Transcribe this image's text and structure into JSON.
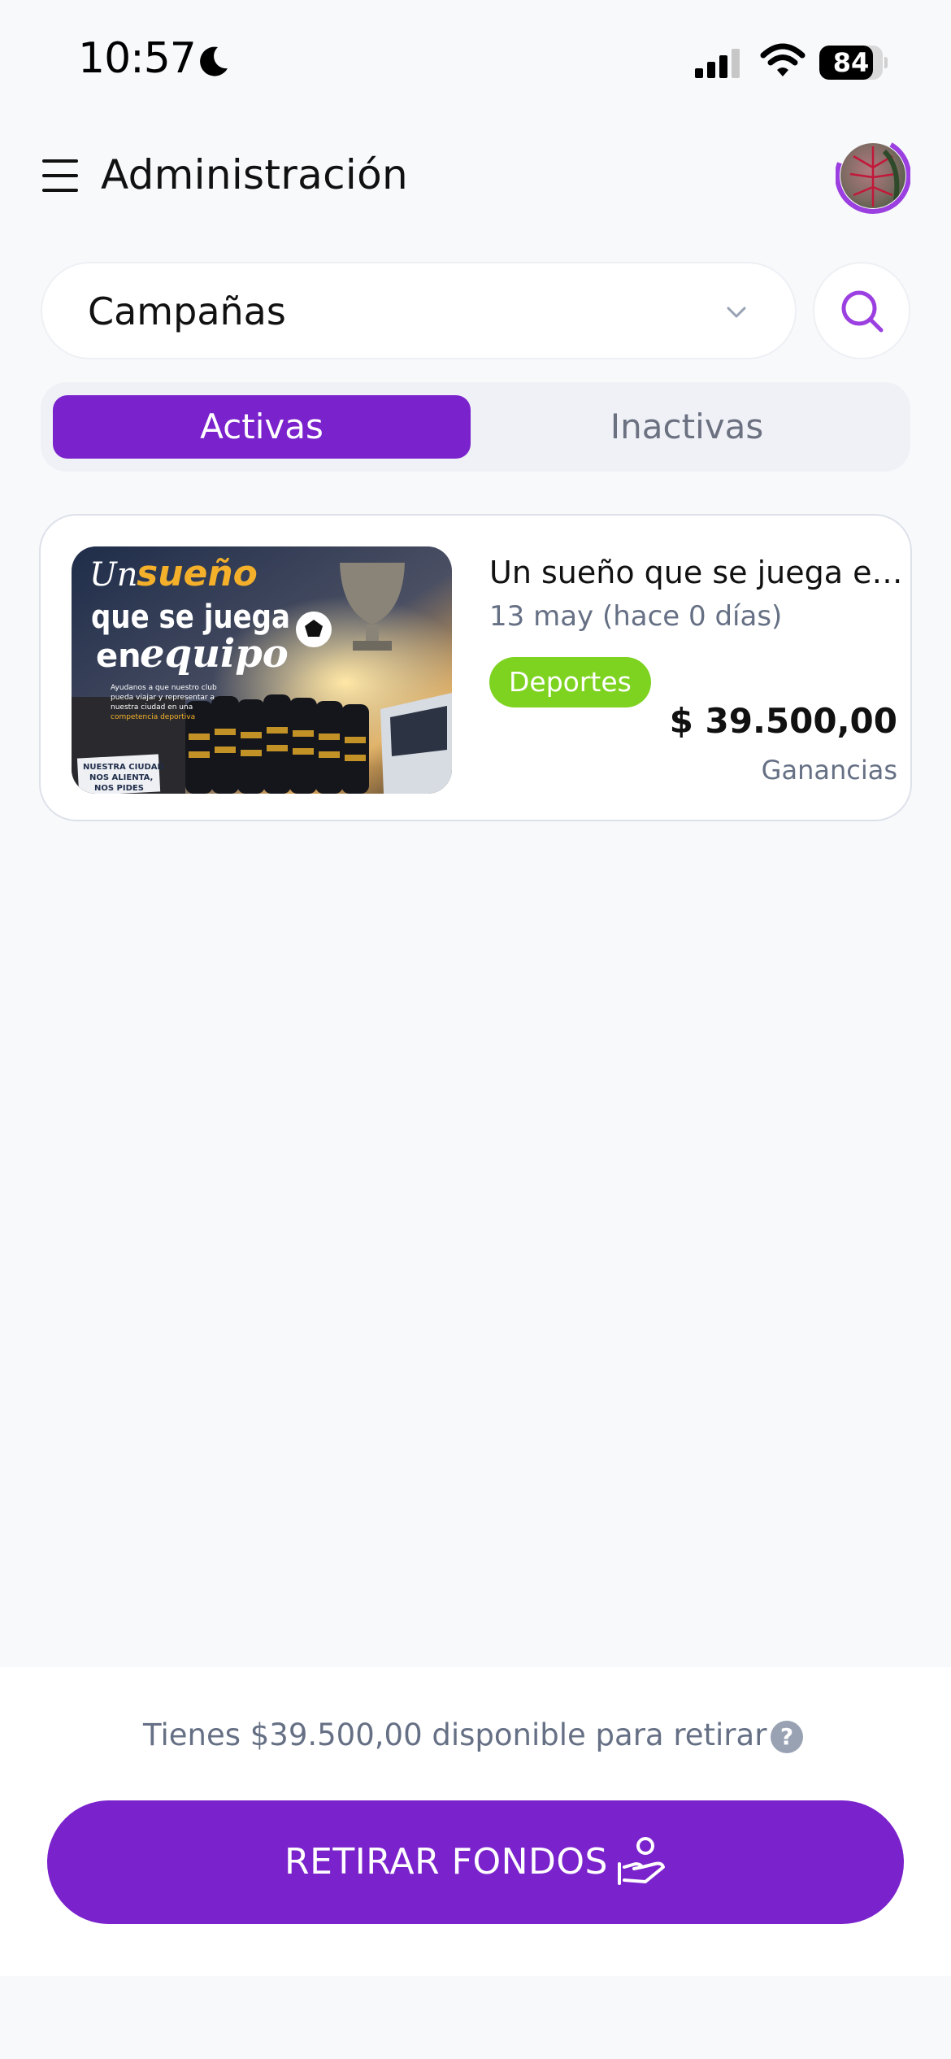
{
  "status_bar": {
    "time": "10:57",
    "battery_level": "84",
    "battery_fraction": 0.84,
    "icons": [
      "moon-icon",
      "cellular-signal-icon",
      "wifi-icon",
      "battery-icon"
    ]
  },
  "header": {
    "title": "Administración",
    "menu_icon": "hamburger-menu-icon",
    "avatar": "profile-avatar"
  },
  "filter": {
    "selected": "Campañas",
    "dropdown_icon": "chevron-down-icon",
    "search_icon": "search-icon"
  },
  "tabs": [
    {
      "label": "Activas",
      "active": true
    },
    {
      "label": "Inactivas",
      "active": false
    }
  ],
  "campaigns": [
    {
      "title": "Un sueño que se juega en equipo",
      "date": "13 may (hace 0 días)",
      "category": "Deportes",
      "amount": "$ 39.500,00",
      "amount_label": "Ganancias",
      "image": {
        "headline_1": "Un",
        "headline_2": "sueño",
        "headline_3": "que se juega",
        "headline_4": "en",
        "headline_5": "equipo",
        "body_lines": [
          "Ayudanos a que nuestro club",
          "pueda viajar y representar a",
          "nuestra ciudad en una",
          "competencia deportiva"
        ],
        "banner_lines": [
          "NUESTRA CIUDAD",
          "NOS ALIENTA,",
          "NOS PIDES"
        ]
      }
    }
  ],
  "footer": {
    "available_text": "Tienes $39.500,00 disponible para retirar",
    "help_icon": "?",
    "withdraw_button": "RETIRAR FONDOS",
    "withdraw_icon": "hand-money-icon"
  },
  "colors": {
    "accent": "#7a22cc",
    "badge": "#7ed321",
    "background": "#f8f9fb",
    "muted_text": "#667085"
  }
}
